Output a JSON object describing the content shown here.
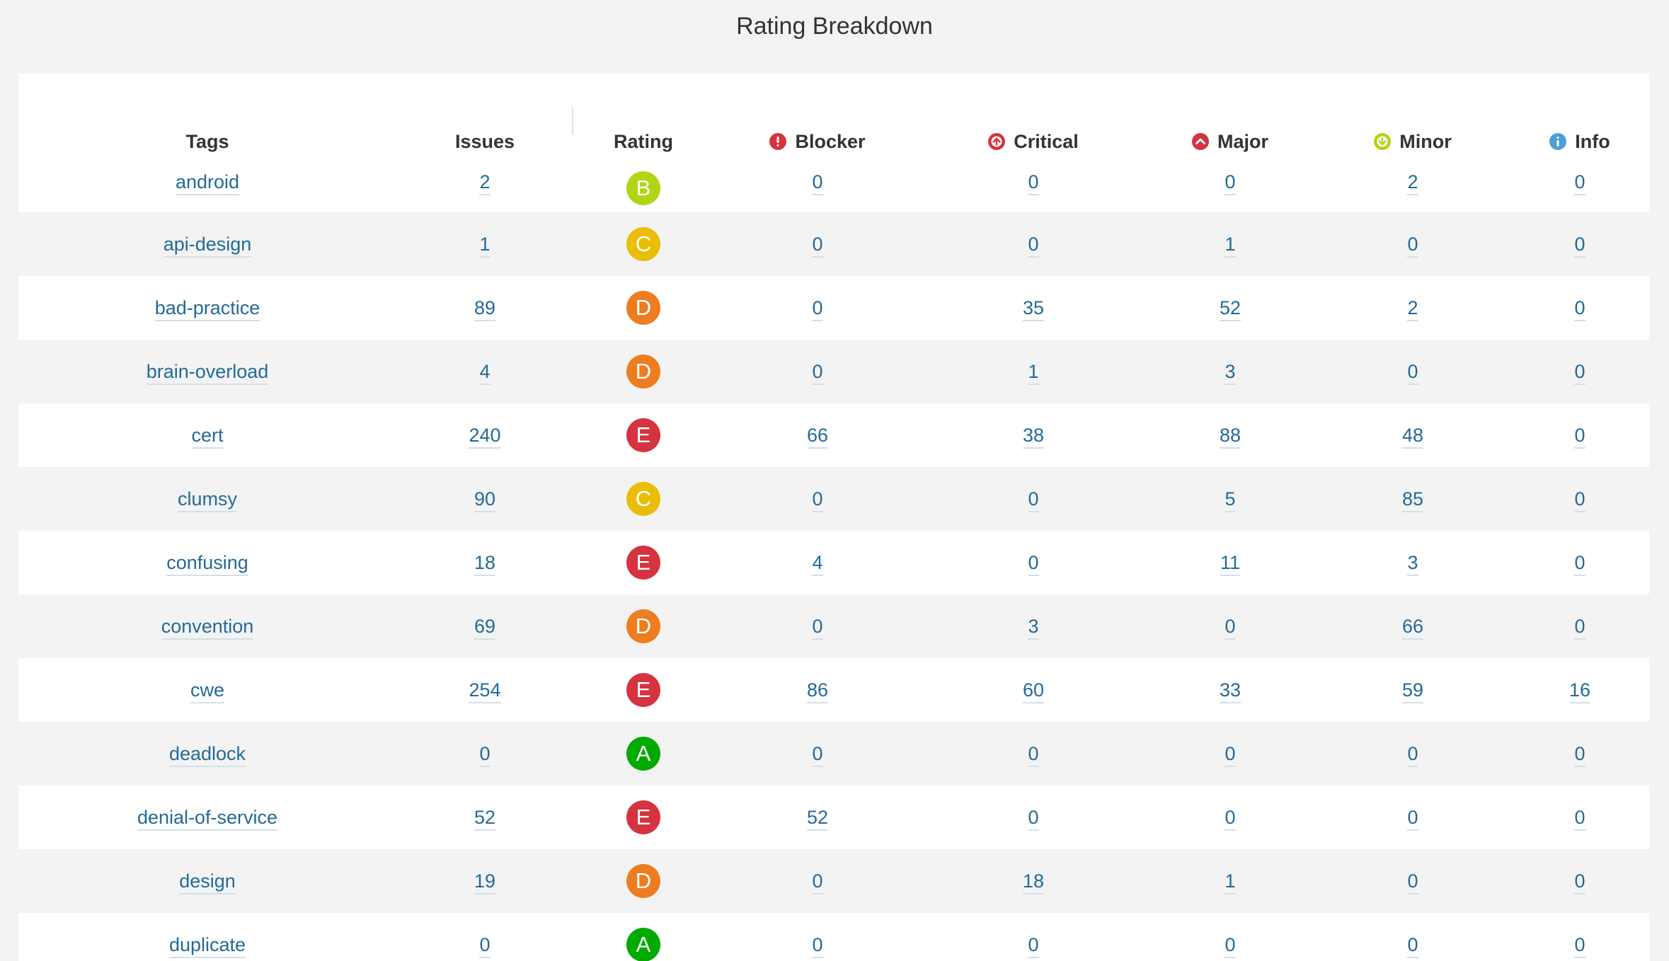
{
  "page": {
    "title": "Rating Breakdown"
  },
  "colors": {
    "A": "#00aa00",
    "B": "#b0d513",
    "C": "#eabe06",
    "D": "#ed7d20",
    "E": "#d4333f",
    "link": "#236a97",
    "blocker": "#d4333f",
    "critical": "#d4333f",
    "major": "#d4333f",
    "minor": "#b0d513",
    "info": "#4b9fd5"
  },
  "columns": {
    "tags": "Tags",
    "issues": "Issues",
    "rating": "Rating",
    "blocker": "Blocker",
    "critical": "Critical",
    "major": "Major",
    "minor": "Minor",
    "info": "Info"
  },
  "severity_icons": {
    "blocker": "blocker-exclamation-icon",
    "critical": "critical-arrow-up-icon",
    "major": "major-chevron-up-icon",
    "minor": "minor-arrow-down-icon",
    "info": "info-i-icon"
  },
  "rows": [
    {
      "tag": "android",
      "issues": "2",
      "rating": "B",
      "blocker": "0",
      "critical": "0",
      "major": "0",
      "minor": "2",
      "info": "0"
    },
    {
      "tag": "api-design",
      "issues": "1",
      "rating": "C",
      "blocker": "0",
      "critical": "0",
      "major": "1",
      "minor": "0",
      "info": "0"
    },
    {
      "tag": "bad-practice",
      "issues": "89",
      "rating": "D",
      "blocker": "0",
      "critical": "35",
      "major": "52",
      "minor": "2",
      "info": "0"
    },
    {
      "tag": "brain-overload",
      "issues": "4",
      "rating": "D",
      "blocker": "0",
      "critical": "1",
      "major": "3",
      "minor": "0",
      "info": "0"
    },
    {
      "tag": "cert",
      "issues": "240",
      "rating": "E",
      "blocker": "66",
      "critical": "38",
      "major": "88",
      "minor": "48",
      "info": "0"
    },
    {
      "tag": "clumsy",
      "issues": "90",
      "rating": "C",
      "blocker": "0",
      "critical": "0",
      "major": "5",
      "minor": "85",
      "info": "0"
    },
    {
      "tag": "confusing",
      "issues": "18",
      "rating": "E",
      "blocker": "4",
      "critical": "0",
      "major": "11",
      "minor": "3",
      "info": "0"
    },
    {
      "tag": "convention",
      "issues": "69",
      "rating": "D",
      "blocker": "0",
      "critical": "3",
      "major": "0",
      "minor": "66",
      "info": "0"
    },
    {
      "tag": "cwe",
      "issues": "254",
      "rating": "E",
      "blocker": "86",
      "critical": "60",
      "major": "33",
      "minor": "59",
      "info": "16"
    },
    {
      "tag": "deadlock",
      "issues": "0",
      "rating": "A",
      "blocker": "0",
      "critical": "0",
      "major": "0",
      "minor": "0",
      "info": "0"
    },
    {
      "tag": "denial-of-service",
      "issues": "52",
      "rating": "E",
      "blocker": "52",
      "critical": "0",
      "major": "0",
      "minor": "0",
      "info": "0"
    },
    {
      "tag": "design",
      "issues": "19",
      "rating": "D",
      "blocker": "0",
      "critical": "18",
      "major": "1",
      "minor": "0",
      "info": "0"
    },
    {
      "tag": "duplicate",
      "issues": "0",
      "rating": "A",
      "blocker": "0",
      "critical": "0",
      "major": "0",
      "minor": "0",
      "info": "0"
    }
  ]
}
